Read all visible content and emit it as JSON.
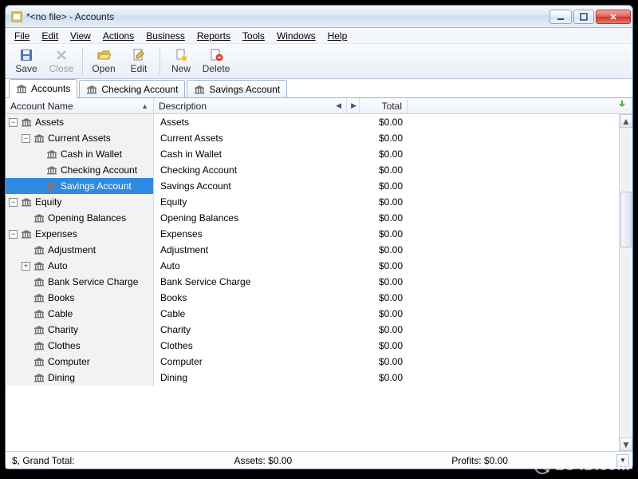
{
  "window": {
    "title": "*<no file> - Accounts"
  },
  "menubar": [
    "File",
    "Edit",
    "View",
    "Actions",
    "Business",
    "Reports",
    "Tools",
    "Windows",
    "Help"
  ],
  "toolbar": {
    "save": "Save",
    "close": "Close",
    "open": "Open",
    "edit": "Edit",
    "new": "New",
    "delete": "Delete"
  },
  "tabs": [
    {
      "label": "Accounts",
      "active": true
    },
    {
      "label": "Checking Account",
      "active": false
    },
    {
      "label": "Savings Account",
      "active": false
    }
  ],
  "columns": {
    "name": "Account Name",
    "desc": "Description",
    "total": "Total"
  },
  "rows": [
    {
      "indent": 0,
      "expand": "minus",
      "icon": true,
      "name": "Assets",
      "desc": "Assets",
      "total": "$0.00"
    },
    {
      "indent": 1,
      "expand": "minus",
      "icon": true,
      "name": "Current Assets",
      "desc": "Current Assets",
      "total": "$0.00"
    },
    {
      "indent": 2,
      "expand": null,
      "icon": true,
      "name": "Cash in Wallet",
      "desc": "Cash in Wallet",
      "total": "$0.00"
    },
    {
      "indent": 2,
      "expand": null,
      "icon": true,
      "name": "Checking Account",
      "desc": "Checking Account",
      "total": "$0.00"
    },
    {
      "indent": 2,
      "expand": null,
      "icon": true,
      "name": "Savings Account",
      "desc": "Savings Account",
      "total": "$0.00",
      "selected": true
    },
    {
      "indent": 0,
      "expand": "minus",
      "icon": true,
      "name": "Equity",
      "desc": "Equity",
      "total": "$0.00"
    },
    {
      "indent": 1,
      "expand": null,
      "icon": true,
      "name": "Opening Balances",
      "desc": "Opening Balances",
      "total": "$0.00"
    },
    {
      "indent": 0,
      "expand": "minus",
      "icon": true,
      "name": "Expenses",
      "desc": "Expenses",
      "total": "$0.00"
    },
    {
      "indent": 1,
      "expand": null,
      "icon": true,
      "name": "Adjustment",
      "desc": "Adjustment",
      "total": "$0.00"
    },
    {
      "indent": 1,
      "expand": "plus",
      "icon": true,
      "name": "Auto",
      "desc": "Auto",
      "total": "$0.00"
    },
    {
      "indent": 1,
      "expand": null,
      "icon": true,
      "name": "Bank Service Charge",
      "desc": "Bank Service Charge",
      "total": "$0.00"
    },
    {
      "indent": 1,
      "expand": null,
      "icon": true,
      "name": "Books",
      "desc": "Books",
      "total": "$0.00"
    },
    {
      "indent": 1,
      "expand": null,
      "icon": true,
      "name": "Cable",
      "desc": "Cable",
      "total": "$0.00"
    },
    {
      "indent": 1,
      "expand": null,
      "icon": true,
      "name": "Charity",
      "desc": "Charity",
      "total": "$0.00"
    },
    {
      "indent": 1,
      "expand": null,
      "icon": true,
      "name": "Clothes",
      "desc": "Clothes",
      "total": "$0.00"
    },
    {
      "indent": 1,
      "expand": null,
      "icon": true,
      "name": "Computer",
      "desc": "Computer",
      "total": "$0.00"
    },
    {
      "indent": 1,
      "expand": null,
      "icon": true,
      "name": "Dining",
      "desc": "Dining",
      "total": "$0.00"
    }
  ],
  "status": {
    "grand": "$, Grand Total:",
    "assets": "Assets:  $0.00",
    "profits": "Profits:  $0.00"
  }
}
